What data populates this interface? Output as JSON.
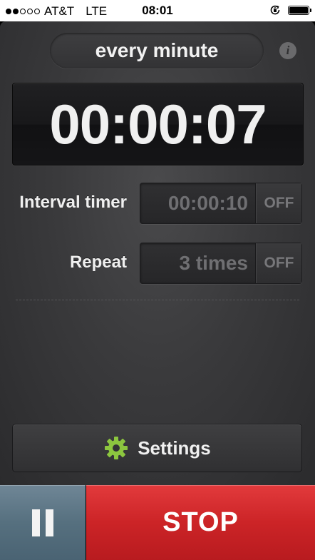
{
  "status_bar": {
    "carrier": "AT&T",
    "network": "LTE",
    "time": "08:01",
    "signal_bars_filled": 2,
    "signal_bars_total": 5,
    "battery_level": 1.0
  },
  "mode": {
    "label": "every minute",
    "info_icon": "info-icon",
    "info_glyph": "i"
  },
  "timer": {
    "elapsed": "00:00:07"
  },
  "interval": {
    "label": "Interval timer",
    "value": "00:00:10",
    "toggle": "OFF"
  },
  "repeat": {
    "label": "Repeat",
    "value": "3 times",
    "toggle": "OFF"
  },
  "settings": {
    "label": "Settings",
    "icon": "gear-icon",
    "icon_color": "#8cc63f"
  },
  "controls": {
    "pause_icon": "pause-icon",
    "stop_label": "STOP",
    "pause_color": "#5b7585",
    "stop_color": "#cc2427"
  }
}
